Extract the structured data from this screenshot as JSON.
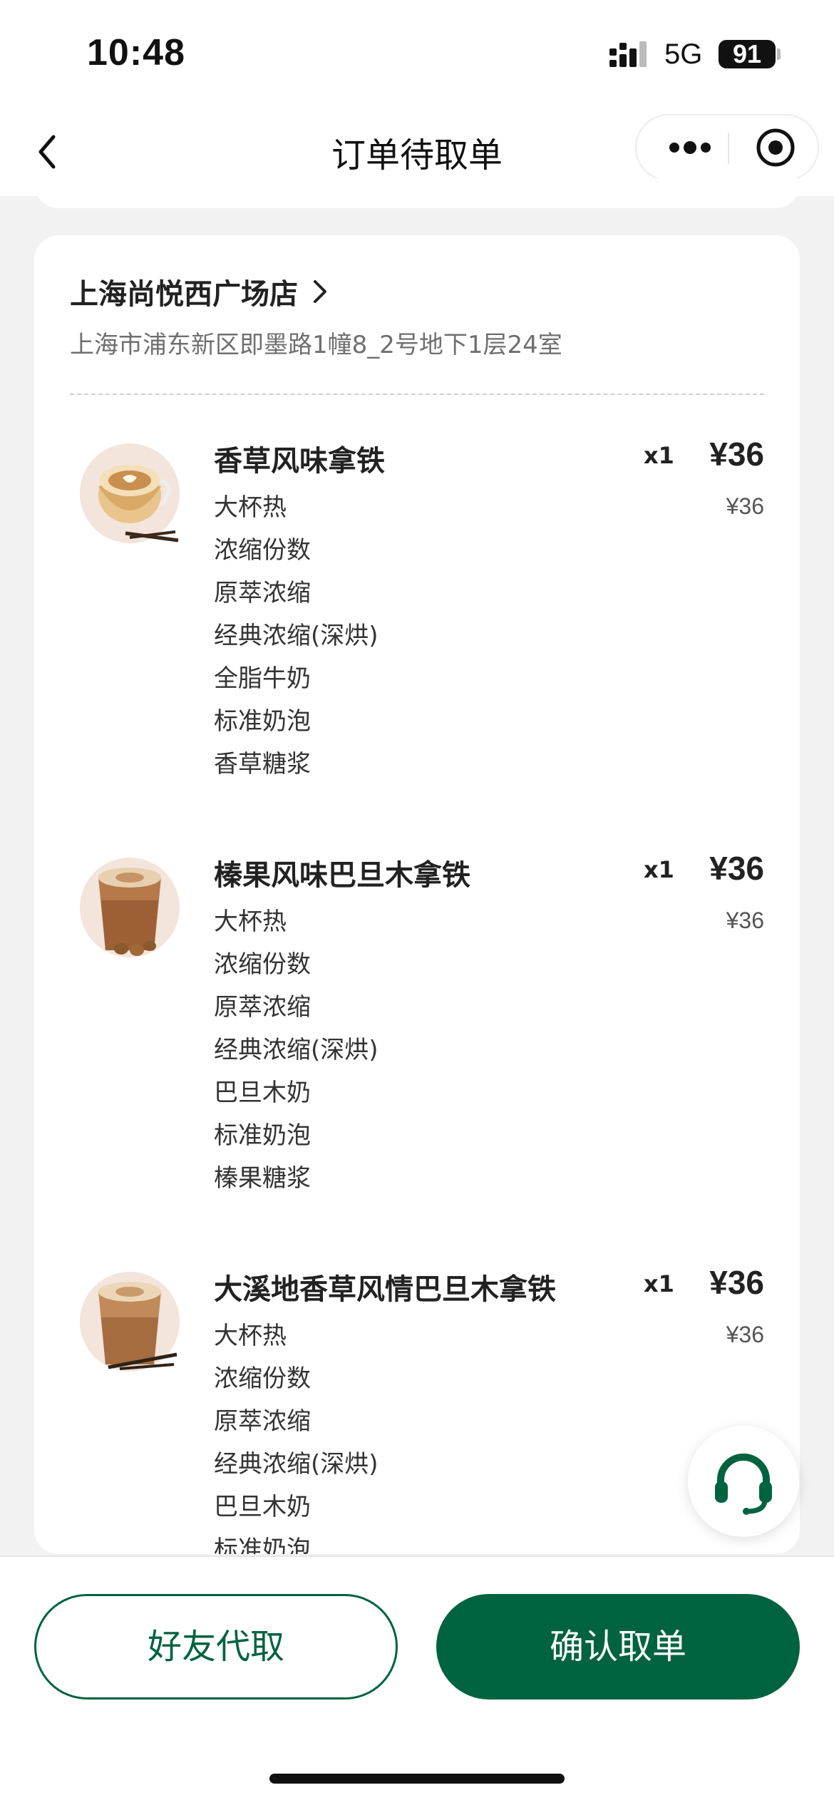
{
  "status_bar": {
    "time": "10:48",
    "network": "5G",
    "battery": "91"
  },
  "nav": {
    "title": "订单待取单",
    "back_icon": "chevron-left-icon",
    "more_icon": "more-dots-icon",
    "close_icon": "target-close-icon"
  },
  "store": {
    "name": "上海尚悦西广场店",
    "address": "上海市浦东新区即墨路1幢8_2号地下1层24室"
  },
  "items": [
    {
      "name": "香草风味拿铁",
      "quantity": "x1",
      "price": "¥36",
      "unit_price": "¥36",
      "options": [
        "大杯热",
        "浓缩份数",
        "原萃浓缩",
        "经典浓缩(深烘)",
        "全脂牛奶",
        "标准奶泡",
        "香草糖浆"
      ]
    },
    {
      "name": "榛果风味巴旦木拿铁",
      "quantity": "x1",
      "price": "¥36",
      "unit_price": "¥36",
      "options": [
        "大杯热",
        "浓缩份数",
        "原萃浓缩",
        "经典浓缩(深烘)",
        "巴旦木奶",
        "标准奶泡",
        "榛果糖浆"
      ]
    },
    {
      "name": "大溪地香草风情巴旦木拿铁",
      "quantity": "x1",
      "price": "¥36",
      "unit_price": "¥36",
      "options": [
        "大杯热",
        "浓缩份数",
        "原萃浓缩",
        "经典浓缩(深烘)",
        "巴旦木奶",
        "标准奶泡"
      ]
    }
  ],
  "service_icon": "headset-icon",
  "actions": {
    "friend_pickup": "好友代取",
    "confirm_pickup": "确认取单"
  },
  "colors": {
    "brand_green": "#00633f",
    "page_bg": "#f2f2f2"
  }
}
